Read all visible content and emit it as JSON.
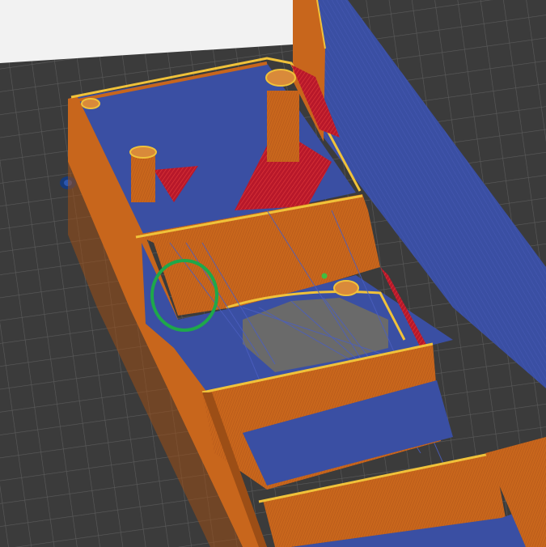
{
  "viewport": {
    "description_label": "",
    "colors": {
      "plate_bg": "#3b3b3b",
      "plate_grid": "#5a5a5a",
      "plate_grid_major": "#6d6d6d",
      "background_panel": "#f2f2f2",
      "wall_orange": "#c8661c",
      "wall_orange_dark": "#9c4e16",
      "wall_orange_light": "#d98a3a",
      "perimeter_yellow": "#f0c23a",
      "infill_blue": "#3a4fa3",
      "travel_blue": "#4b5fc0",
      "overhang_red": "#d21e2e",
      "marker_green": "#1ea84a",
      "marker_dot_green": "#3fbf3f",
      "object_dark_blue": "#163a7a"
    },
    "marker": {
      "type": "circle",
      "meaning": "highlight"
    }
  }
}
